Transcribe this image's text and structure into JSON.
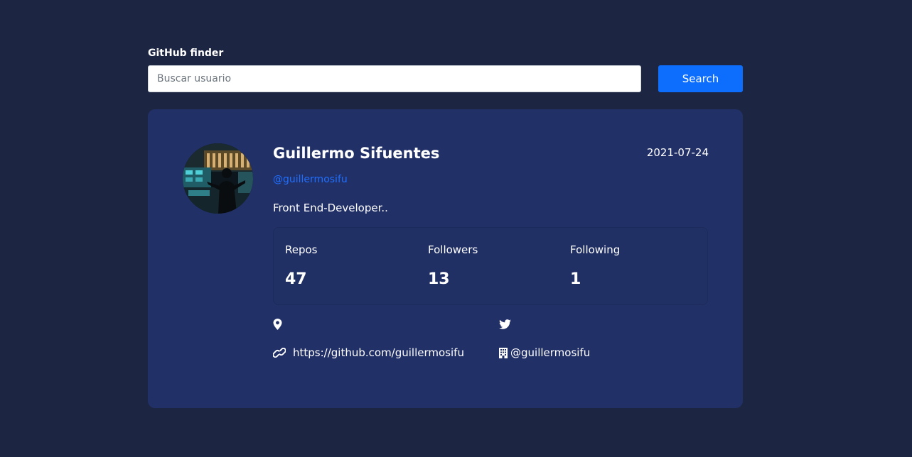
{
  "app": {
    "title": "GitHub finder"
  },
  "search": {
    "placeholder": "Buscar usuario",
    "value": "",
    "button_label": "Search"
  },
  "profile": {
    "name": "Guillermo Sifuentes",
    "joined": "2021-07-24",
    "login": "@guillermosifu",
    "bio": "Front End-Developer..",
    "avatar_icon": "user-avatar-photo"
  },
  "stats": [
    {
      "label": "Repos",
      "value": "47"
    },
    {
      "label": "Followers",
      "value": "13"
    },
    {
      "label": "Following",
      "value": "1"
    }
  ],
  "links": {
    "location": {
      "icon": "location-pin-icon",
      "text": ""
    },
    "twitter": {
      "icon": "twitter-icon",
      "text": ""
    },
    "blog": {
      "icon": "link-icon",
      "text": "https://github.com/guillermosifu"
    },
    "company": {
      "icon": "building-icon",
      "text": "@guillermosifu"
    }
  },
  "colors": {
    "background": "#1c2541",
    "card": "#223068",
    "accent": "#0d6efd",
    "login_link": "#1f6fff"
  }
}
